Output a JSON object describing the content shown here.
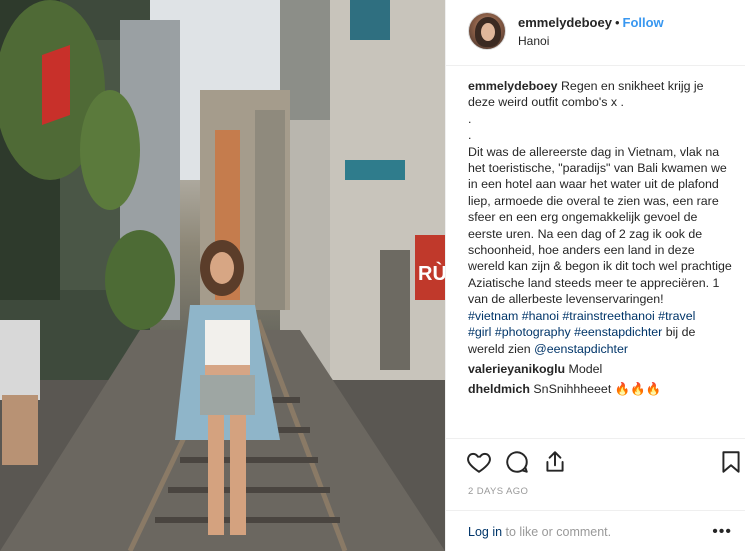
{
  "post": {
    "username": "emmelydeboey",
    "separator": "•",
    "follow_label": "Follow",
    "location": "Hanoi"
  },
  "caption": {
    "username": "emmelydeboey",
    "text_part1": " Regen en snikheet krijg je deze weird outfit combo's x .\n.\n.\nDit was de allereerste dag in Vietnam, vlak na het toeristische, \"paradijs\" van Bali kwamen we in een hotel aan waar het water uit de plafond liep, armoede die overal te zien was, een rare sfeer en een erg ongemakkelijk gevoel de eerste uren. Na een dag of 2 zag ik ook de schoonheid, hoe anders een land in deze wereld kan zijn & begon ik dit toch wel prachtige Aziatische land steeds meer te appreciëren. 1 van de allerbeste levenservaringen!\n",
    "tags": [
      "#vietnam",
      "#hanoi",
      "#trainstreethanoi",
      "#travel",
      "#girl",
      "#photography",
      "#eenstapdichter"
    ],
    "text_part2": " bij de wereld zien ",
    "mention": "@eenstapdichter"
  },
  "comments": [
    {
      "username": "valerieyanikoglu",
      "text": " Model"
    },
    {
      "username": "dheldmich",
      "text": " SnSnihhheeet ",
      "emoji": "🔥🔥🔥"
    }
  ],
  "actions": {
    "like_icon": "heart-icon",
    "comment_icon": "comment-icon",
    "share_icon": "share-icon",
    "save_icon": "bookmark-icon"
  },
  "date": "2 DAYS AGO",
  "footer": {
    "login_link": "Log in",
    "login_rest": " to like or comment.",
    "more": "•••"
  },
  "photo": {
    "sign_text": "RỪ"
  }
}
